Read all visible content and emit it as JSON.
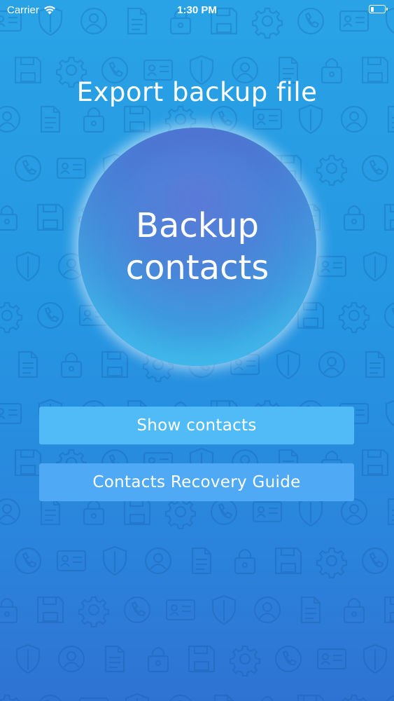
{
  "status_bar": {
    "carrier": "Carrier",
    "time": "1:30 PM",
    "battery_level_percent": 20
  },
  "page": {
    "title": "Export backup file",
    "backup_button_label": "Backup\ncontacts"
  },
  "buttons": {
    "show_contacts": "Show contacts",
    "recovery_guide": "Contacts Recovery Guide"
  },
  "colors": {
    "background_top": "#2aa3e6",
    "background_bottom": "#2f73d2",
    "button": "#50bbf7",
    "text": "#ffffff"
  },
  "icons": {
    "background_pattern": [
      "contact-card-icon",
      "document-icon",
      "gear-icon",
      "shield-icon",
      "lock-icon",
      "phone-icon",
      "user-icon",
      "floppy-disk-icon"
    ]
  }
}
